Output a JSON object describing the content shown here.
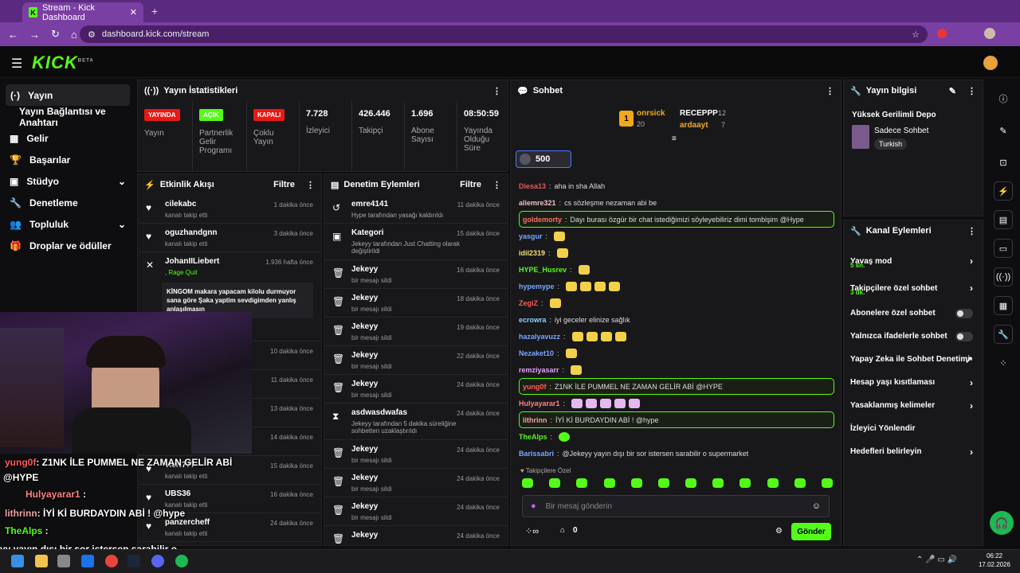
{
  "browser": {
    "tab_title": "Stream - Kick Dashboard",
    "url": "dashboard.kick.com/stream"
  },
  "header": {
    "logo": "KICK",
    "logo_sup": "BETA"
  },
  "sidebar": {
    "items": [
      {
        "label": "Yayın"
      },
      {
        "label": "Yayın Bağlantısı ve Anahtarı"
      },
      {
        "label": "Gelir"
      },
      {
        "label": "Başarılar"
      },
      {
        "label": "Stüdyo"
      },
      {
        "label": "Denetleme"
      },
      {
        "label": "Topluluk"
      },
      {
        "label": "Droplar ve ödüller"
      }
    ]
  },
  "stats": {
    "title": "Yayın İstatistikleri",
    "badges": [
      {
        "badge": "YAYINDA",
        "label": "Yayın",
        "color": "#e91916"
      },
      {
        "badge": "AÇIK",
        "label": "Partnerlik Gelir Programı",
        "color": "#53fc18"
      },
      {
        "badge": "KAPALI",
        "label": "Çoklu Yayın",
        "color": "#e91916"
      }
    ],
    "values": [
      {
        "value": "7.728",
        "label": "İzleyici"
      },
      {
        "value": "426.446",
        "label": "Takipçi"
      },
      {
        "value": "1.696",
        "label": "Abone Sayısı"
      },
      {
        "value": "08:50:59",
        "label": "Yayında Olduğu Süre"
      }
    ]
  },
  "activity": {
    "title": "Etkinlik Akışı",
    "filter": "Filtre",
    "items": [
      {
        "name": "cilekabc",
        "sub": "kanalı takip etti",
        "time": "1 dakika önce"
      },
      {
        "name": "oguzhandgnn",
        "sub": "kanalı takip etti",
        "time": "3 dakika önce"
      },
      {
        "name": "JohanIILiebert",
        "sub": ", Rage Quit",
        "time": "1.936 hafta önce"
      },
      {
        "name": "",
        "sub": "",
        "time": "10 dakika önce"
      },
      {
        "name": "",
        "sub": "",
        "time": "11 dakika önce"
      },
      {
        "name": "",
        "sub": "",
        "time": "13 dakika önce"
      },
      {
        "name": "",
        "sub": "",
        "time": "14 dakika önce"
      },
      {
        "name": "vieN777",
        "sub": "kanalı takip etti",
        "time": "15 dakika önce"
      },
      {
        "name": "UBS36",
        "sub": "kanalı takip etti",
        "time": "16 dakika önce"
      },
      {
        "name": "panzercheff",
        "sub": "kanalı takip etti",
        "time": "24 dakika önce"
      }
    ],
    "message": "KİNGOM makara yapacam kilolu durmuyor sana göre Şaka yaptim sevdigimden yanlış anlaşılmasın"
  },
  "moderation": {
    "title": "Denetim Eylemleri",
    "filter": "Filtre",
    "items": [
      {
        "name": "emre4141",
        "sub": "Hype tarafından yasağı kaldırıldı",
        "time": "11 dakika önce"
      },
      {
        "name": "Kategori",
        "sub": "Jekeyy tarafından Just Chatting olarak değiştirildi",
        "time": "15 dakika önce"
      },
      {
        "name": "Jekeyy",
        "sub": "bir mesajı sildi",
        "time": "16 dakika önce"
      },
      {
        "name": "Jekeyy",
        "sub": "bir mesajı sildi",
        "time": "18 dakika önce"
      },
      {
        "name": "Jekeyy",
        "sub": "bir mesajı sildi",
        "time": "19 dakika önce"
      },
      {
        "name": "Jekeyy",
        "sub": "bir mesajı sildi",
        "time": "22 dakika önce"
      },
      {
        "name": "Jekeyy",
        "sub": "bir mesajı sildi",
        "time": "24 dakika önce"
      },
      {
        "name": "asdwasdwafas",
        "sub": "Jekeyy tarafından 5 dakika süreliğine sohbetten uzaklaştırıldı",
        "time": "24 dakika önce"
      },
      {
        "name": "Jekeyy",
        "sub": "bir mesajı sildi",
        "time": "24 dakika önce"
      },
      {
        "name": "Jekeyy",
        "sub": "bir mesajı sildi",
        "time": "24 dakika önce"
      },
      {
        "name": "Jekeyy",
        "sub": "bir mesajı sildi",
        "time": "24 dakika önce"
      },
      {
        "name": "Jekeyy",
        "sub": "",
        "time": "24 dakika önce"
      }
    ]
  },
  "chat": {
    "title": "Sohbet",
    "leader": {
      "name": "onrsick",
      "count": "20",
      "rank": "1"
    },
    "leader2": [
      {
        "name": "RECEPPP",
        "count": "12"
      },
      {
        "name": "ardaayt",
        "count": "7"
      }
    ],
    "goal": "500",
    "messages": [
      {
        "user": "Diesa13",
        "text": "aha in sha Allah",
        "color": "#e05a5a",
        "hl": false
      },
      {
        "user": "aliemre321",
        "text": "cs sözleşme nezaman abi be",
        "color": "#f0c0c0",
        "hl": false
      },
      {
        "user": "goldemorty",
        "text": "Dayı burası özgür bir chat istediğimizi söyleyebiliriz dimi tombişim @Hype",
        "color": "#ff6b6b",
        "hl": true
      },
      {
        "user": "yasgur",
        "text": "",
        "color": "#7aa7ff",
        "hl": false
      },
      {
        "user": "idil2319",
        "text": "",
        "color": "#f0e07a",
        "hl": false
      },
      {
        "user": "HYPE_Husrev",
        "text": "",
        "color": "#53fc18",
        "hl": false
      },
      {
        "user": "hypemype",
        "text": "",
        "color": "#7aa7ff",
        "hl": false
      },
      {
        "user": "ZegiZ",
        "text": "",
        "color": "#ff5a5a",
        "hl": false
      },
      {
        "user": "ecrowra",
        "text": "iyi geceler elinize sağlık",
        "color": "#8fd0ff",
        "hl": false
      },
      {
        "user": "hazalyavuzz",
        "text": "",
        "color": "#7aa7ff",
        "hl": false
      },
      {
        "user": "Nezaket10",
        "text": "",
        "color": "#7aa7ff",
        "hl": false
      },
      {
        "user": "remziyasarr",
        "text": "",
        "color": "#e6a0ff",
        "hl": false
      },
      {
        "user": "yung0f",
        "text": "Z1NK İLE PUMMEL NE ZAMAN GELİR ABİ @HYPE",
        "color": "#ff5a5a",
        "hl": true
      },
      {
        "user": "Hulyayarar1",
        "text": "",
        "color": "#ff8080",
        "hl": false
      },
      {
        "user": "lithrinn",
        "text": "İYİ Kİ BURDAYDIN ABİ ! @hype",
        "color": "#f0a0a0",
        "hl": true
      },
      {
        "user": "TheAlps",
        "text": "",
        "color": "#53fc18",
        "hl": false
      },
      {
        "user": "Barissabri",
        "text": "@Jekeyy yayın dışı bir sor istersen sarabilir o supermarket",
        "color": "#7aa7ff",
        "hl": false
      }
    ],
    "follower_only": "Takipçilere Özel",
    "placeholder": "Bir mesaj gönderin",
    "points": "0",
    "send": "Gönder"
  },
  "stream_info": {
    "title": "Yayın bilgisi",
    "stream_title": "Yüksek Gerilimli Depo",
    "category": "Sadece Sohbet",
    "tag": "Turkish"
  },
  "channel_actions": {
    "title": "Kanal Eylemleri",
    "items": [
      {
        "label": "Yavaş mod",
        "sub": "5 sn.",
        "kind": "chevron"
      },
      {
        "label": "Takipçilere özel sohbet",
        "sub": "3 dk.",
        "kind": "chevron"
      },
      {
        "label": "Abonelere özel sohbet",
        "sub": "",
        "kind": "toggle"
      },
      {
        "label": "Yalnızca ifadelerle sohbet",
        "sub": "",
        "kind": "toggle"
      },
      {
        "label": "Yapay Zeka ile Sohbet Denetimi",
        "sub": "",
        "kind": "link"
      },
      {
        "label": "Hesap yaşı kısıtlaması",
        "sub": "",
        "kind": "chevron"
      },
      {
        "label": "Yasaklanmış kelimeler",
        "sub": "",
        "kind": "chevron"
      },
      {
        "label": "İzleyici Yönlendir",
        "sub": "",
        "kind": "none"
      },
      {
        "label": "Hedefleri belirleyin",
        "sub": "",
        "kind": "chevron"
      }
    ]
  },
  "overlay": {
    "lines": [
      {
        "user": "yung0f",
        "text": ": Z1NK İLE PUMMEL NE ZAMAN GELİR ABİ",
        "color": "#ff5a5a"
      },
      {
        "user": "",
        "text": "@HYPE",
        "color": "#fff"
      },
      {
        "user": "Hulyayarar1",
        "text": " :",
        "color": "#ff8080"
      },
      {
        "user": "lithrinn",
        "text": ": İYİ Kİ BURDAYDIN ABİ ! @hype",
        "color": "#f0a0a0"
      },
      {
        "user": "TheAlps",
        "text": " :",
        "color": "#53fc18"
      },
      {
        "user": "",
        "text": "yy yayın dışı bir sor istersen sarabilir o",
        "color": "#fff"
      }
    ]
  },
  "taskbar": {
    "time": "06:22",
    "date": "17.02.2026"
  }
}
